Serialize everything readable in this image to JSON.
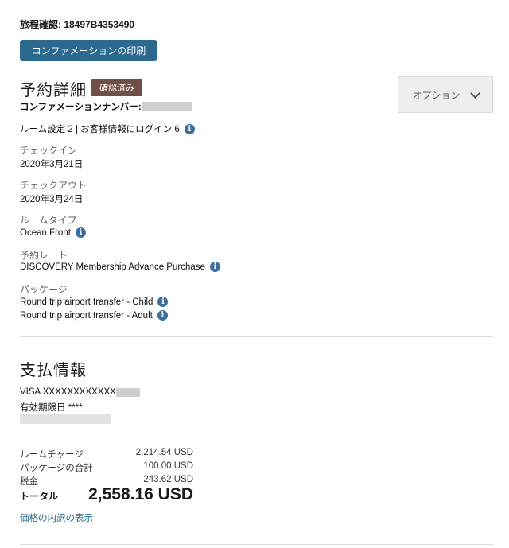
{
  "itinerary": {
    "label": "旅程確認: 18497B4353490"
  },
  "print_button": "コンファメーションの印刷",
  "reservation": {
    "title": "予約詳細",
    "status_badge": "確認済み",
    "options_label": "オプション",
    "confirmation_label": "コンファメーションナンバー: ",
    "room_setup": "ルーム設定 2 | お客様情報にログイン 6",
    "checkin_label": "チェックイン",
    "checkin_value": "2020年3月21日",
    "checkout_label": "チェックアウト",
    "checkout_value": "2020年3月24日",
    "room_type_label": "ルームタイプ",
    "room_type_value": "Ocean Front",
    "rate_label": "予約レート",
    "rate_value": "DISCOVERY Membership Advance Purchase",
    "package_label": "パッケージ",
    "packages": [
      "Round trip airport transfer - Child",
      "Round trip airport transfer - Adult"
    ]
  },
  "payment": {
    "title": "支払情報",
    "card": "VISA XXXXXXXXXXXX",
    "expiry": "有効期限日 ****",
    "charges": [
      {
        "label": "ルームチャージ",
        "value": "2,214.54 USD"
      },
      {
        "label": "パッケージの合計",
        "value": "100.00 USD"
      },
      {
        "label": "税金",
        "value": "243.62 USD"
      }
    ],
    "total_label": "トータル",
    "total_value": "2,558.16 USD",
    "breakdown_link": "価格の内訳の表示"
  },
  "icons": {
    "info": "info-icon",
    "options_chevron": "chevron-down-icon"
  },
  "colors": {
    "primary": "#2b6a8e",
    "badge": "#6e5047",
    "info": "#3c6fa0"
  }
}
